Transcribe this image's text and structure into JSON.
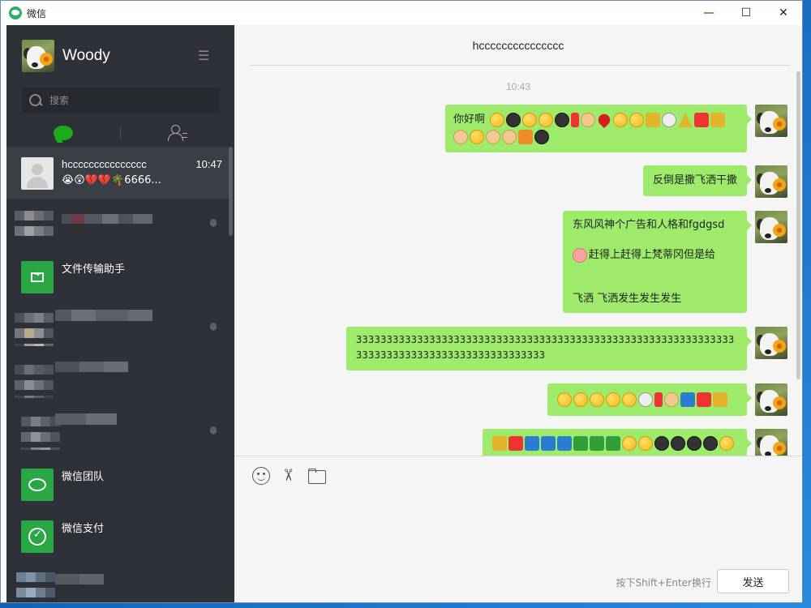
{
  "window": {
    "title": "微信",
    "controls": {
      "minimize": "—",
      "maximize": "☐",
      "close": "✕"
    }
  },
  "sidebar": {
    "profile_name": "Woody",
    "menu_icon": "☰",
    "search_placeholder": "搜索",
    "tabs": [
      {
        "name": "chats",
        "icon": "chat-bubble-icon",
        "active": true
      },
      {
        "name": "contacts",
        "icon": "contacts-icon",
        "active": false
      }
    ],
    "conversations": [
      {
        "name": "hccccccccccccccc",
        "time": "10:47",
        "preview": "😭😲💔💔🌴6666...",
        "active": true
      },
      {
        "name": "",
        "blurred": true,
        "muted": true
      },
      {
        "name": "文件传输助手",
        "icon": "folder-icon"
      },
      {
        "name": "",
        "blurred": true,
        "muted": true
      },
      {
        "name": "",
        "blurred": true
      },
      {
        "name": "",
        "blurred": true,
        "muted": true
      },
      {
        "name": "微信团队",
        "icon": "wechat-icon"
      },
      {
        "name": "微信支付",
        "icon": "pay-icon"
      },
      {
        "name": "",
        "blurred": true
      }
    ]
  },
  "chat": {
    "title": "hccccccccccccccc",
    "timestamp": "10:43",
    "messages": [
      {
        "text_prefix": "你好啊"
      },
      {
        "text": "反倒是撒飞洒干撒"
      },
      {
        "line1": "东风风神个广告和人格和fgdgsd",
        "line2": "赶得上赶得上梵蒂冈但是给",
        "line3": "飞洒 飞洒发生发生发生"
      },
      {
        "text": "333333333333333333333333333333333333333333333333333333333333333333333333333333333333333333333"
      },
      {
        "text": ""
      },
      {
        "text": ""
      }
    ],
    "send_hint": "按下Shift+Enter换行",
    "send_label": "发送"
  }
}
